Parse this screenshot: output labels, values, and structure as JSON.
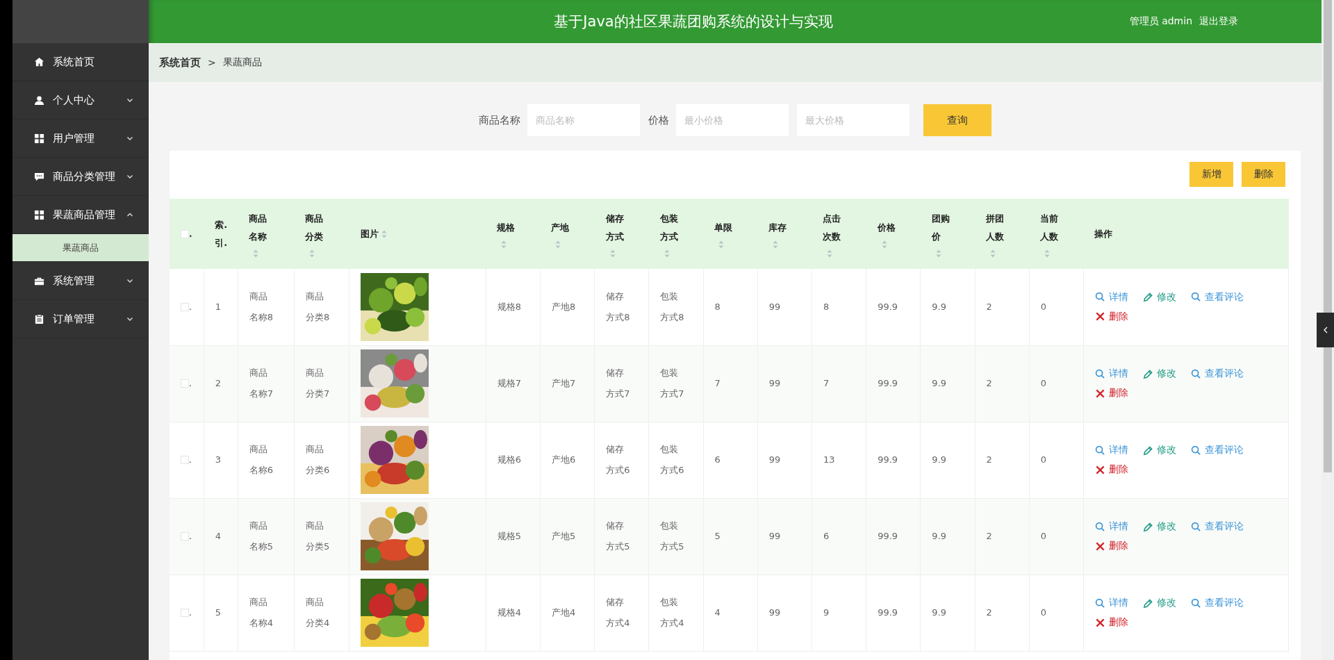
{
  "header": {
    "title": "基于Java的社区果蔬团购系统的设计与实现",
    "user": "管理员 admin",
    "logout": "退出登录"
  },
  "sidebar": {
    "items": [
      {
        "label": "系统首页"
      },
      {
        "label": "个人中心",
        "expanded": false
      },
      {
        "label": "用户管理",
        "expanded": false
      },
      {
        "label": "商品分类管理",
        "expanded": false
      },
      {
        "label": "果蔬商品管理",
        "expanded": true,
        "children": [
          {
            "label": "果蔬商品",
            "selected": true
          }
        ]
      },
      {
        "label": "系统管理",
        "expanded": false
      },
      {
        "label": "订单管理",
        "expanded": false
      }
    ]
  },
  "breadcrumb": [
    "系统首页",
    ">",
    "果蔬商品"
  ],
  "search": {
    "fields": [
      {
        "label": "商品名称",
        "placeholder": "商品名称"
      },
      {
        "label": "价格",
        "placeholder": "最小价格"
      },
      {
        "placeholder": "最大价格"
      }
    ],
    "button": "查询"
  },
  "toolbar": [
    "新增",
    "删除"
  ],
  "table": {
    "select_all": {
      "checked": false,
      "suffix": "."
    },
    "columns": [
      {
        "label": "索.引.",
        "sortable": false
      },
      {
        "label": "商品名称",
        "sortable": true
      },
      {
        "label": "商品分类",
        "sortable": true
      },
      {
        "label": "图片",
        "sortable": true
      },
      {
        "label": "规格",
        "sortable": true
      },
      {
        "label": "产地",
        "sortable": true
      },
      {
        "label": "储存方式",
        "sortable": true
      },
      {
        "label": "包装方式",
        "sortable": true
      },
      {
        "label": "单限",
        "sortable": true
      },
      {
        "label": "库存",
        "sortable": true
      },
      {
        "label": "点击次数",
        "sortable": true
      },
      {
        "label": "价格",
        "sortable": true
      },
      {
        "label": "团购价",
        "sortable": true
      },
      {
        "label": "拼团人数",
        "sortable": true
      },
      {
        "label": "当前人数",
        "sortable": true
      },
      {
        "label": "操作",
        "sortable": false
      }
    ],
    "rows": [
      {
        "checked": false,
        "suffix": ".",
        "cells": [
          "1",
          "商品名称8",
          "商品分类8",
          {
            "kind": "picture"
          },
          "规格8",
          "产地8",
          "储存方式8",
          "包装方式8",
          "8",
          "99",
          "8",
          "99.9",
          "9.9",
          "2",
          "0"
        ],
        "actions": [
          {
            "kind": "detail",
            "label": "详情"
          },
          {
            "kind": "edit",
            "label": "修改"
          },
          {
            "kind": "comments",
            "label": "查看评论"
          },
          {
            "kind": "delete",
            "label": "删除"
          }
        ]
      },
      {
        "checked": false,
        "suffix": ".",
        "cells": [
          "2",
          "商品名称7",
          "商品分类7",
          {
            "kind": "picture"
          },
          "规格7",
          "产地7",
          "储存方式7",
          "包装方式7",
          "7",
          "99",
          "7",
          "99.9",
          "9.9",
          "2",
          "0"
        ],
        "actions": [
          {
            "kind": "detail",
            "label": "详情"
          },
          {
            "kind": "edit",
            "label": "修改"
          },
          {
            "kind": "comments",
            "label": "查看评论"
          },
          {
            "kind": "delete",
            "label": "删除"
          }
        ]
      },
      {
        "checked": false,
        "suffix": ".",
        "cells": [
          "3",
          "商品名称6",
          "商品分类6",
          {
            "kind": "picture"
          },
          "规格6",
          "产地6",
          "储存方式6",
          "包装方式6",
          "6",
          "99",
          "13",
          "99.9",
          "9.9",
          "2",
          "0"
        ],
        "actions": [
          {
            "kind": "detail",
            "label": "详情"
          },
          {
            "kind": "edit",
            "label": "修改"
          },
          {
            "kind": "comments",
            "label": "查看评论"
          },
          {
            "kind": "delete",
            "label": "删除"
          }
        ]
      },
      {
        "checked": false,
        "suffix": ".",
        "cells": [
          "4",
          "商品名称5",
          "商品分类5",
          {
            "kind": "picture"
          },
          "规格5",
          "产地5",
          "储存方式5",
          "包装方式5",
          "5",
          "99",
          "6",
          "99.9",
          "9.9",
          "2",
          "0"
        ],
        "actions": [
          {
            "kind": "detail",
            "label": "详情"
          },
          {
            "kind": "edit",
            "label": "修改"
          },
          {
            "kind": "comments",
            "label": "查看评论"
          },
          {
            "kind": "delete",
            "label": "删除"
          }
        ]
      },
      {
        "checked": false,
        "suffix": ".",
        "cells": [
          "5",
          "商品名称4",
          "商品分类4",
          {
            "kind": "picture"
          },
          "规格4",
          "产地4",
          "储存方式4",
          "包装方式4",
          "4",
          "99",
          "9",
          "99.9",
          "9.9",
          "2",
          "0"
        ],
        "actions": [
          {
            "kind": "detail",
            "label": "详情"
          },
          {
            "kind": "edit",
            "label": "修改"
          },
          {
            "kind": "comments",
            "label": "查看评论"
          },
          {
            "kind": "delete",
            "label": "删除"
          }
        ]
      }
    ]
  }
}
